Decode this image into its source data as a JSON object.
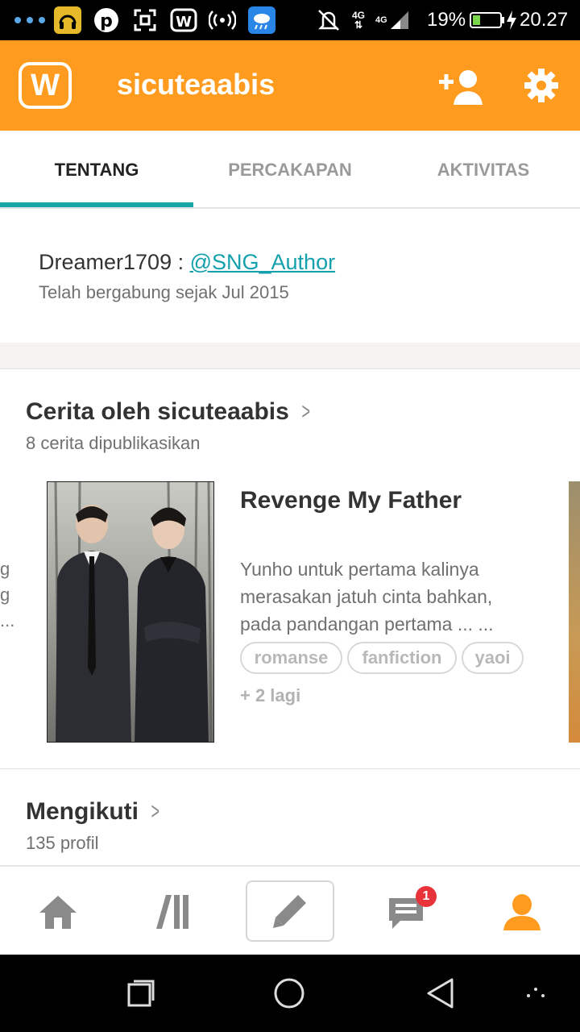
{
  "status_bar": {
    "battery": "19%",
    "time": "20.27",
    "network_top": "4G",
    "network_bottom": "4G"
  },
  "app_bar": {
    "title": "sicuteaabis",
    "logo_letter": "W",
    "brand_color": "#ff9c1f"
  },
  "tabs": [
    {
      "label": "TENTANG",
      "active": true
    },
    {
      "label": "PERCAKAPAN",
      "active": false
    },
    {
      "label": "AKTIVITAS",
      "active": false
    }
  ],
  "about": {
    "text_prefix": "Dreamer1709 : ",
    "mention": "@SNG_Author",
    "joined": "Telah bergabung sejak Jul 2015"
  },
  "stories": {
    "title": "Cerita oleh sicuteaabis",
    "subtitle": "8 cerita dipublikasikan",
    "story": {
      "title": "Revenge My Father",
      "description": "Yunho untuk pertama kalinya merasakan jatuh cinta bahkan, pada pandangan pertama ... ...",
      "tags": [
        "romanse",
        "fanfiction",
        "yaoi"
      ],
      "more_tags": "+ 2 lagi"
    },
    "left_peek": [
      "g",
      "g",
      "..."
    ]
  },
  "following": {
    "title": "Mengikuti",
    "subtitle": "135 profil"
  },
  "bottom_nav": {
    "items": [
      {
        "name": "home-icon"
      },
      {
        "name": "library-icon"
      },
      {
        "name": "write-icon"
      },
      {
        "name": "messages-icon"
      },
      {
        "name": "profile-icon"
      }
    ],
    "message_badge": "1",
    "active_color": "#ff9c1f",
    "inactive_color": "#8a8a8a"
  }
}
